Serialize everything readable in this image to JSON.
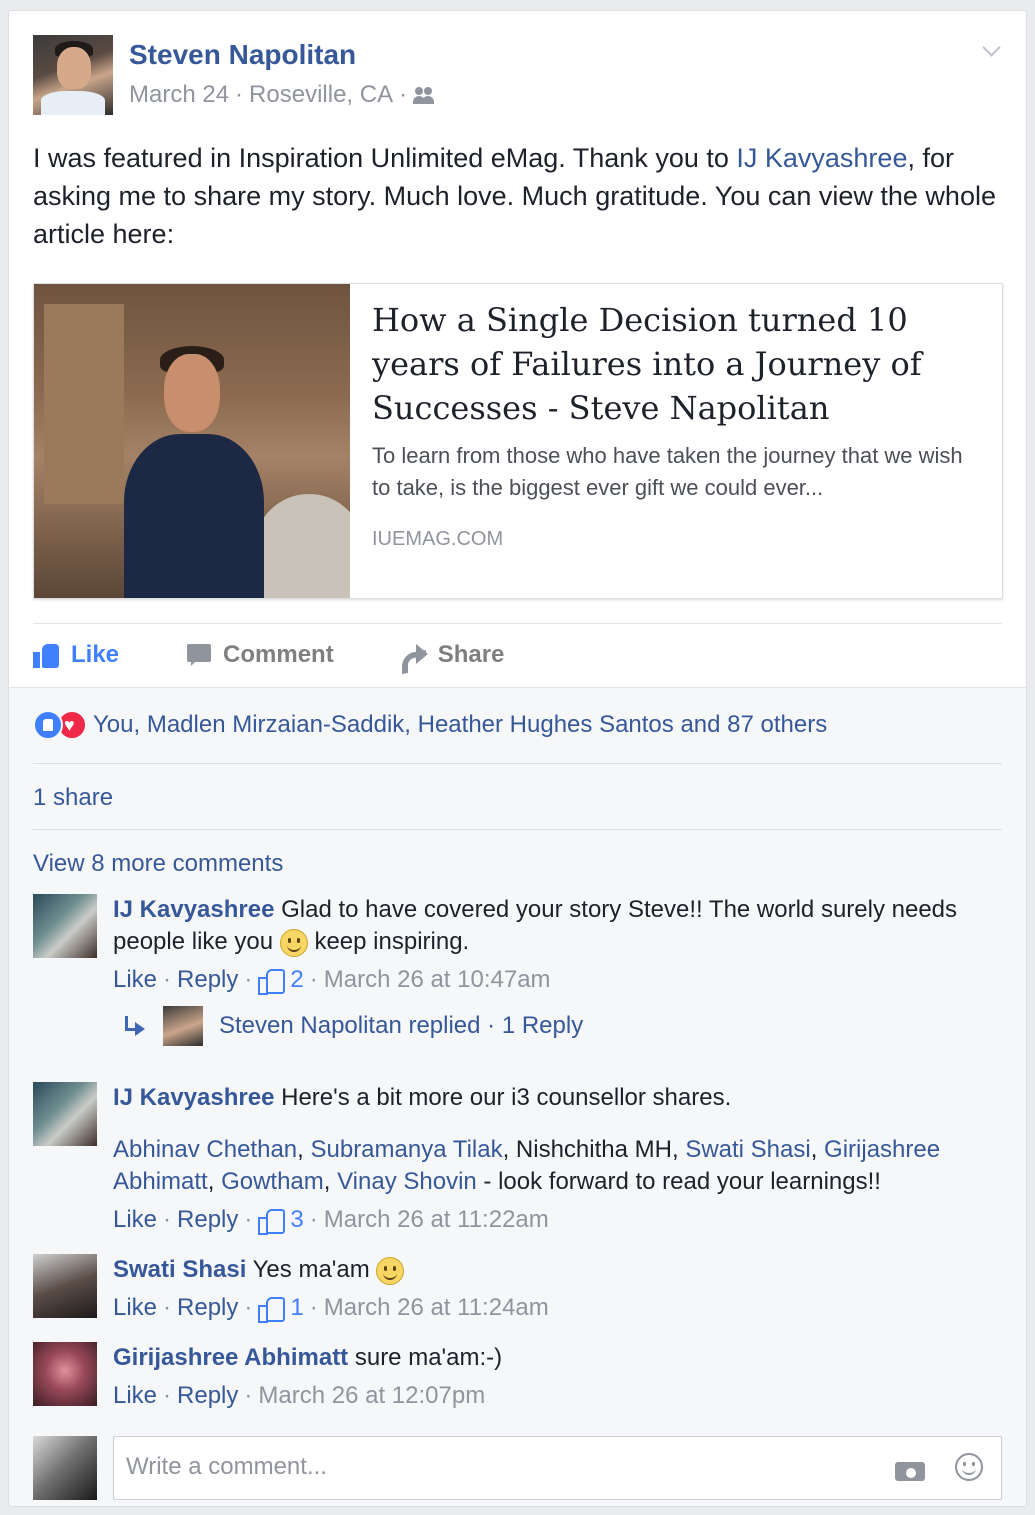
{
  "post": {
    "author": "Steven Napolitan",
    "date": "March 24",
    "location": "Roseville, CA",
    "separator": "·",
    "audience_icon": "friends-icon",
    "text_before": "I was featured in Inspiration Unlimited eMag. Thank you to ",
    "text_mention": "IJ Kavyashree",
    "text_after": ", for asking me to share my story. Much love. Much gratitude. You can view the whole article here:"
  },
  "link_preview": {
    "title": "How a Single Decision turned 10 years of Failures into a Journey of Successes - Steve Napolitan",
    "description": "To learn from those who have taken the journey that we wish to take, is the biggest ever gift we could ever...",
    "domain": "IUEMAG.COM"
  },
  "actions": {
    "like": "Like",
    "comment": "Comment",
    "share": "Share"
  },
  "reactions": {
    "summary": "You, Madlen Mirzaian-Saddik, Heather Hughes Santos and 87 others"
  },
  "shares": "1 share",
  "view_more": "View 8 more comments",
  "comments": [
    {
      "name": "IJ Kavyashree",
      "text_before": "Glad to have covered your story Steve!! The world surely needs people like you ",
      "text_after": " keep inspiring.",
      "like_label": "Like",
      "reply_label": "Reply",
      "likes": "2",
      "time": "March 26 at 10:47am",
      "reply_summary": "Steven Napolitan replied · 1 Reply"
    },
    {
      "name": "IJ Kavyashree",
      "text": "Here's a bit more our i3 counsellor shares.",
      "mentions": [
        "Abhinav Chethan",
        "Subramanya Tilak",
        "Nishchitha MH",
        "Swati Shasi",
        "Girijashree Abhimatt",
        "Gowtham",
        "Vinay Shovin"
      ],
      "sep": ", ",
      "tail": " - look forward to read your learnings!!",
      "like_label": "Like",
      "reply_label": "Reply",
      "likes": "3",
      "time": "March 26 at 11:22am"
    },
    {
      "name": "Swati Shasi",
      "text": "Yes ma'am ",
      "like_label": "Like",
      "reply_label": "Reply",
      "likes": "1",
      "time": "March 26 at 11:24am"
    },
    {
      "name": "Girijashree Abhimatt",
      "text": "sure ma'am:-)",
      "like_label": "Like",
      "reply_label": "Reply",
      "time": "March 26 at 12:07pm"
    }
  ],
  "composer": {
    "placeholder": "Write a comment..."
  }
}
